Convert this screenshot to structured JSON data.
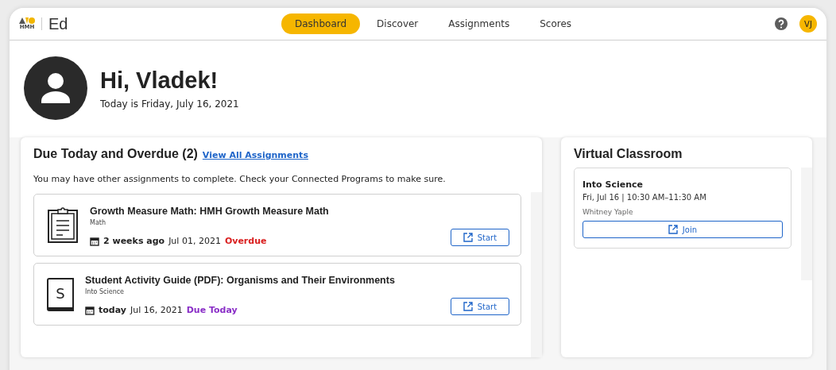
{
  "header": {
    "logo_text": "HMH",
    "app_name": "Ed",
    "nav": [
      {
        "label": "Dashboard",
        "selected": true
      },
      {
        "label": "Discover",
        "selected": false
      },
      {
        "label": "Assignments",
        "selected": false
      },
      {
        "label": "Scores",
        "selected": false
      }
    ],
    "avatar_initials": "VJ"
  },
  "greeting": {
    "title": "Hi, Vladek!",
    "date": "Today is Friday, July 16, 2021"
  },
  "due_panel": {
    "title": "Due Today and Overdue (2)",
    "link": "View All Assignments",
    "note": "You may have other assignments to complete. Check your Connected Programs to make sure.",
    "assignments": [
      {
        "title": "Growth Measure Math: HMH Growth Measure Math",
        "subject": "Math",
        "relative": "2 weeks ago",
        "date": "Jul 01, 2021",
        "status": "Overdue",
        "kind": "overdue",
        "button": "Start"
      },
      {
        "icon_letter": "S",
        "title": "Student Activity Guide (PDF): Organisms and Their Environments",
        "subject": "Into Science",
        "relative": "today",
        "date": "Jul 16, 2021",
        "status": "Due Today",
        "kind": "due",
        "button": "Start"
      }
    ]
  },
  "classroom_panel": {
    "title": "Virtual Classroom",
    "sessions": [
      {
        "title": "Into Science",
        "time": "Fri, Jul 16 | 10:30 AM–11:30 AM",
        "teacher": "Whitney Yaple",
        "button": "Join"
      }
    ]
  }
}
